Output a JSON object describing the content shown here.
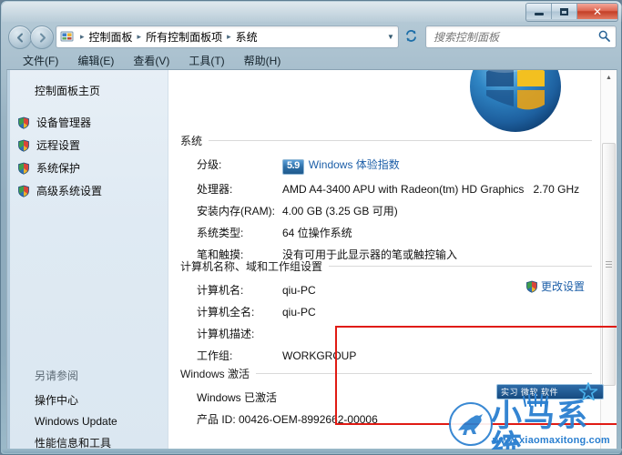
{
  "window": {
    "controls": {
      "minimize": "minimize",
      "maximize": "maximize",
      "close": "✕"
    }
  },
  "nav": {
    "back_tooltip": "back",
    "forward_tooltip": "forward",
    "breadcrumbs": [
      "控制面板",
      "所有控制面板项",
      "系统"
    ],
    "separator": "▸",
    "refresh_glyph": "↻"
  },
  "search": {
    "placeholder": "搜索控制面板",
    "value": ""
  },
  "menubar": {
    "items": [
      "文件(F)",
      "编辑(E)",
      "查看(V)",
      "工具(T)",
      "帮助(H)"
    ]
  },
  "sidebar": {
    "home": "控制面板主页",
    "items": [
      {
        "label": "设备管理器"
      },
      {
        "label": "远程设置"
      },
      {
        "label": "系统保护"
      },
      {
        "label": "高级系统设置"
      }
    ],
    "see_also_title": "另请参阅",
    "see_also": [
      {
        "label": "操作中心"
      },
      {
        "label": "Windows Update"
      },
      {
        "label": "性能信息和工具"
      }
    ]
  },
  "system_section": {
    "title": "系统",
    "rows": [
      {
        "label": "分级:",
        "value": "",
        "rating": "5.9",
        "link": "Windows 体验指数"
      },
      {
        "label": "处理器:",
        "value": "AMD A4-3400 APU with Radeon(tm) HD Graphics   2.70 GHz"
      },
      {
        "label": "安装内存(RAM):",
        "value": "4.00 GB (3.25 GB 可用)"
      },
      {
        "label": "系统类型:",
        "value": "64 位操作系统"
      },
      {
        "label": "笔和触摸:",
        "value": "没有可用于此显示器的笔或触控输入"
      }
    ]
  },
  "computer_section": {
    "title": "计算机名称、域和工作组设置",
    "rows": [
      {
        "label": "计算机名:",
        "value": "qiu-PC"
      },
      {
        "label": "计算机全名:",
        "value": "qiu-PC"
      },
      {
        "label": "计算机描述:",
        "value": ""
      },
      {
        "label": "工作组:",
        "value": "WORKGROUP"
      }
    ],
    "change_settings": "更改设置"
  },
  "activation_section": {
    "title": "Windows 激活",
    "status": "Windows 已激活",
    "product_id": "产品 ID: 00426-OEM-8992662-00006"
  },
  "watermark": {
    "banner": "实习 微软 软件",
    "title": "小马系统",
    "url": "www.xiaomaxitong.com"
  },
  "colors": {
    "accent_link": "#1d5fa8",
    "annotation_red": "#e01b14",
    "watermark_blue": "#2a7fd0"
  }
}
